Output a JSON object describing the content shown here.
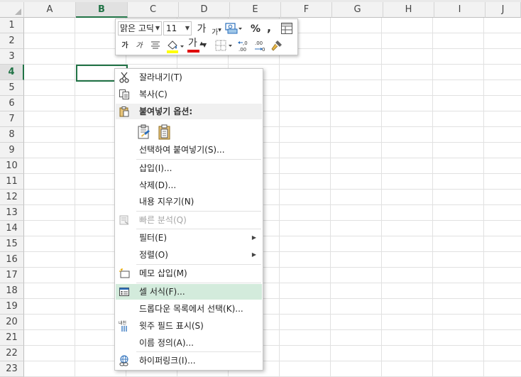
{
  "sheet": {
    "columns": [
      "A",
      "B",
      "C",
      "D",
      "E",
      "F",
      "G",
      "H",
      "I",
      "J"
    ],
    "selected_column": "B",
    "rows": [
      "1",
      "2",
      "3",
      "4",
      "5",
      "6",
      "7",
      "8",
      "9",
      "10",
      "11",
      "12",
      "13",
      "14",
      "15",
      "16",
      "17",
      "18",
      "19",
      "20",
      "21",
      "22",
      "23"
    ],
    "selected_row": "4"
  },
  "mini_toolbar": {
    "font_name": "맑은 고딕",
    "font_size": "11",
    "grow_font": "가",
    "shrink_font": "가",
    "percent": "%",
    "comma": ",",
    "bold": "가",
    "italic": "가",
    "font_color_glyph": "가",
    "dec_increase": ".00",
    "dec_decrease": ".00"
  },
  "context_menu": {
    "cut": "잘라내기(T)",
    "copy": "복사(C)",
    "paste_options_header": "붙여넣기 옵션:",
    "paste_special": "선택하여 붙여넣기(S)...",
    "insert": "삽입(I)...",
    "delete": "삭제(D)...",
    "clear_contents": "내용 지우기(N)",
    "quick_analysis": "빠른 분석(Q)",
    "filter": "필터(E)",
    "sort": "정렬(O)",
    "insert_comment": "메모 삽입(M)",
    "format_cells": "셀 서식(F)...",
    "pick_from_list": "드롭다운 목록에서 선택(K)...",
    "phonetic": "윗주 필드 표시(S)",
    "define_name": "이름 정의(A)...",
    "hyperlink": "하이퍼링크(I)...",
    "phonetic_icon_glyph": "내천"
  },
  "colors": {
    "accent": "#217346",
    "highlight": "#d3ebdc"
  }
}
